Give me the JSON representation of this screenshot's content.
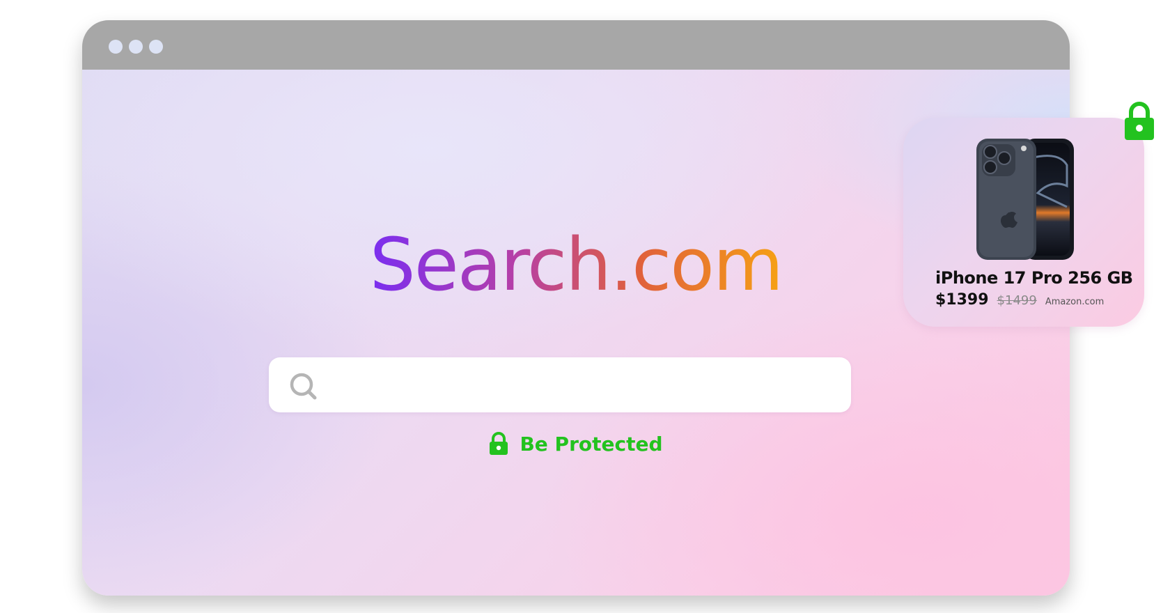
{
  "window": {
    "controls": [
      "dot",
      "dot",
      "dot"
    ]
  },
  "page": {
    "logo_text": "Search.com",
    "search": {
      "value": "",
      "placeholder": ""
    },
    "protection": {
      "label": "Be Protected",
      "icon": "lock-icon"
    }
  },
  "product_card": {
    "title": "iPhone 17 Pro 256 GB",
    "price": "$1399",
    "old_price": "$1499",
    "store": "Amazon.com",
    "icon": "lock-icon"
  },
  "colors": {
    "accent_green": "#23c21f",
    "logo_gradient": [
      "#7a2ef0",
      "#b53fa8",
      "#e0603c",
      "#f6a114"
    ],
    "titlebar": "#a7a7a7"
  }
}
